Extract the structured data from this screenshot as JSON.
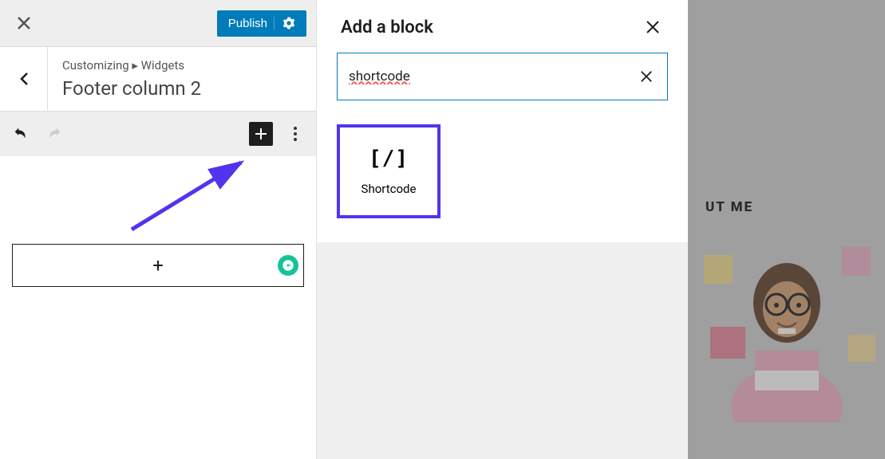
{
  "header": {
    "publish_label": "Publish"
  },
  "breadcrumb": {
    "path": "Customizing ▸ Widgets",
    "title": "Footer column 2"
  },
  "block_panel": {
    "title": "Add a block",
    "search_value": "shortcode",
    "results": [
      {
        "icon": "[/]",
        "label": "Shortcode"
      }
    ]
  },
  "preview": {
    "about_heading": "UT ME"
  }
}
